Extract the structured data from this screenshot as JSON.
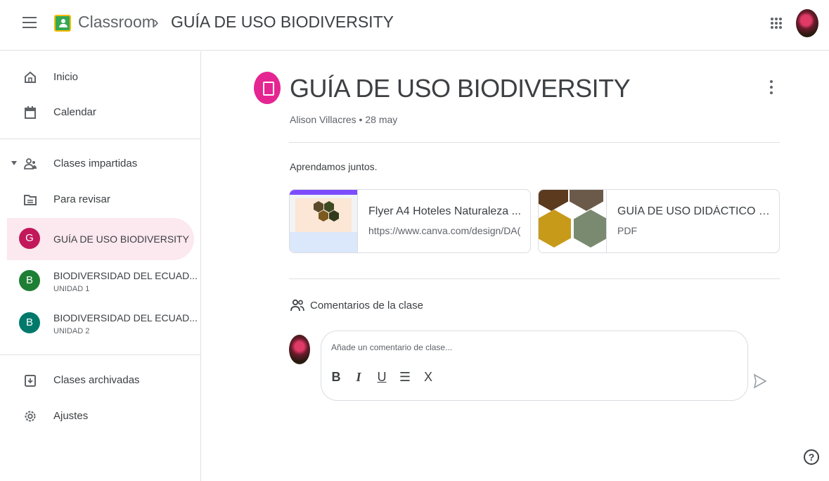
{
  "header": {
    "app_name": "Classroom",
    "separator": "›",
    "class_title": "GUÍA DE USO BIODIVERSITY",
    "icons": [
      "menu-icon",
      "classroom-logo-icon",
      "apps-grid-icon",
      "account-avatar"
    ]
  },
  "sidebar": {
    "top_items": [
      {
        "label": "Inicio",
        "icon": "home-icon"
      },
      {
        "label": "Calendar",
        "icon": "calendar-icon"
      }
    ],
    "section": {
      "label": "Clases impartidas",
      "icon": "people-icon"
    },
    "review": {
      "label": "Para revisar",
      "icon": "folder-icon"
    },
    "classes": [
      {
        "initial": "G",
        "name": "GUÍA DE USO BIODIVERSITY",
        "sub": "",
        "color": "#c2185b",
        "active": true
      },
      {
        "initial": "B",
        "name": "BIODIVERSIDAD DEL ECUAD...",
        "sub": "UNIDAD 1",
        "color": "#1e7e34",
        "active": false
      },
      {
        "initial": "B",
        "name": "BIODIVERSIDAD DEL ECUAD...",
        "sub": "UNIDAD 2",
        "color": "#00796b",
        "active": false
      }
    ],
    "bottom_items": [
      {
        "label": "Clases archivadas",
        "icon": "archive-icon"
      },
      {
        "label": "Ajustes",
        "icon": "settings-gear-icon"
      }
    ]
  },
  "post": {
    "title": "GUÍA DE USO BIODIVERSITY",
    "meta": "Alison Villacres • 28 may",
    "body": "Aprendamos juntos.",
    "attachments": [
      {
        "title": "Flyer A4 Hoteles Naturaleza ...",
        "subtitle": "https://www.canva.com/design/DA("
      },
      {
        "title": "GUÍA DE USO DIDÁCTICO BI...",
        "subtitle": "PDF"
      }
    ]
  },
  "comments": {
    "label": "Comentarios de la clase",
    "placeholder": "Añade un comentario de clase...",
    "format_buttons": [
      "B",
      "I",
      "U",
      "☰",
      "X"
    ]
  },
  "colors": {
    "accent": "#e52592",
    "active_bg": "#fce8ef",
    "divider": "#e0e0e0"
  }
}
